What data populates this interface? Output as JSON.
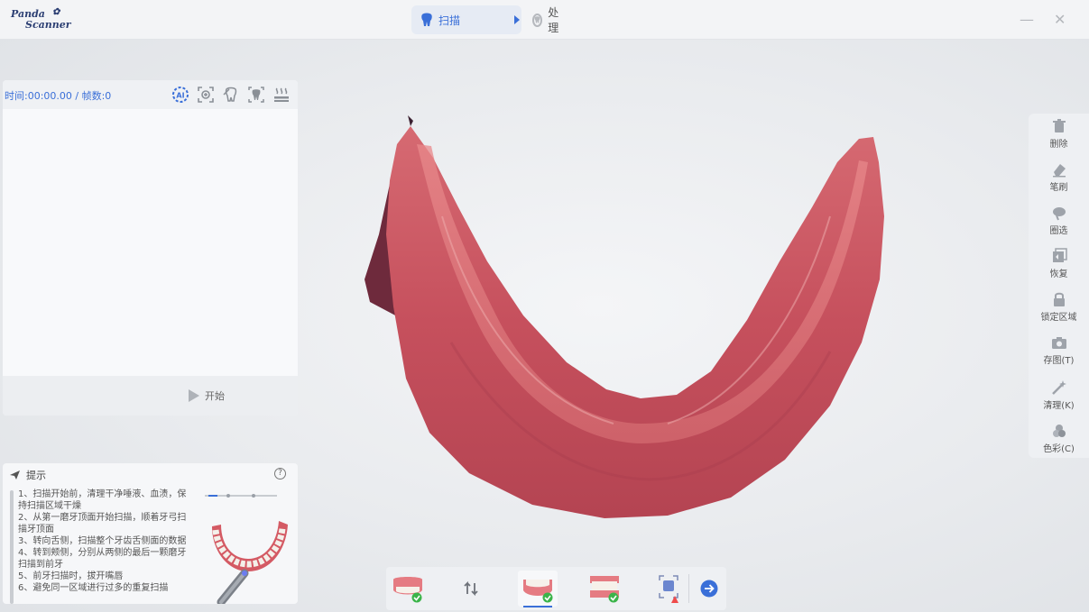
{
  "app": {
    "logo_line1": "Panda",
    "logo_line2": "Scanner"
  },
  "header": {
    "tabs": [
      {
        "label": "扫描",
        "active": true
      },
      {
        "label": "处理",
        "active": false
      }
    ],
    "minimize_icon": "minimize-icon",
    "close_icon": "close-icon"
  },
  "scan_panel": {
    "time_info": "时间:00:00.00 / 帧数:0",
    "header_icons": [
      "ai-icon",
      "focus-scan-icon",
      "tooth-scan-icon",
      "tooth-display-icon",
      "heat-icon"
    ],
    "start_label": "开始"
  },
  "tips": {
    "title": "提示",
    "lines": [
      "1、扫描开始前，清理干净唾液、血渍，保持扫描区域干燥",
      "2、从第一磨牙顶面开始扫描，顺着牙弓扫描牙顶面",
      "3、转向舌侧，扫描整个牙齿舌侧面的数据",
      "4、转到颊侧，分别从两侧的最后一颗磨牙扫描到前牙",
      "5、前牙扫描时，拔开嘴唇",
      "6、避免同一区域进行过多的重复扫描"
    ]
  },
  "right_tools": [
    {
      "label": "删除",
      "icon": "trash-icon"
    },
    {
      "label": "笔刷",
      "icon": "eraser-icon"
    },
    {
      "label": "圈选",
      "icon": "lasso-icon"
    },
    {
      "label": "恢复",
      "icon": "restore-icon"
    },
    {
      "label": "锁定区域",
      "icon": "lock-icon"
    },
    {
      "label": "存图(T)",
      "icon": "camera-icon"
    },
    {
      "label": "清理(K)",
      "icon": "magic-wand-icon"
    },
    {
      "label": "色彩(C)",
      "icon": "color-icon"
    }
  ],
  "bottom_bar": {
    "items": [
      "upper-jaw-icon",
      "swap-jaw-icon",
      "lower-jaw-icon",
      "bite-icon",
      "bite-warning-icon",
      "next-icon"
    ]
  },
  "colors": {
    "accent": "#3a6fd8",
    "model_tissue": "#c2505c",
    "check_green": "#3bb44a"
  }
}
